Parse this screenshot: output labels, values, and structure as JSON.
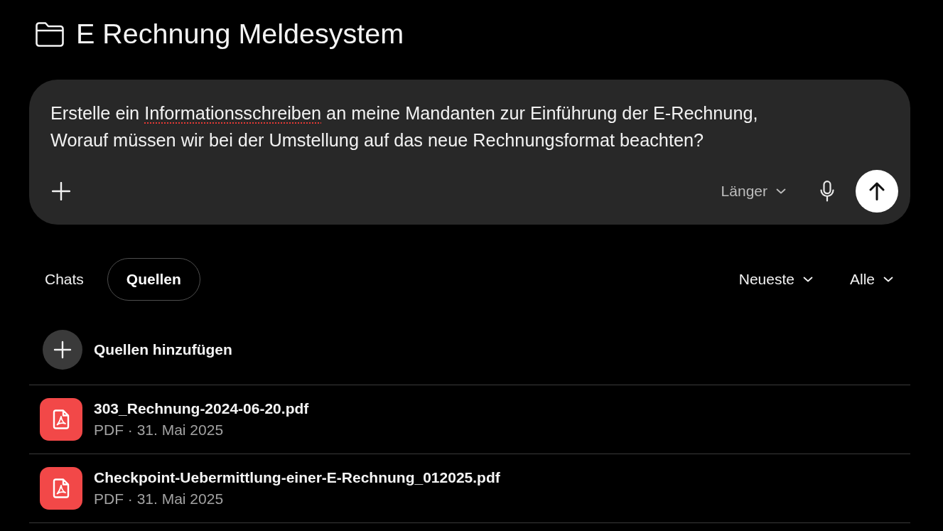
{
  "header": {
    "title": "E Rechnung Meldesystem"
  },
  "composer": {
    "prompt": [
      {
        "text": "Erstelle ein ",
        "misspelled": false
      },
      {
        "text": "Informationsschreiben",
        "misspelled": true
      },
      {
        "text": " an meine Mandanten zur Einführung der E-Rechnung,\nWorauf müssen wir bei der Umstellung auf das neue Rechnungsformat beachten?",
        "misspelled": false
      }
    ],
    "length_option": {
      "label": "Länger"
    }
  },
  "tabs": [
    {
      "label": "Chats",
      "selected": false
    },
    {
      "label": "Quellen",
      "selected": true
    }
  ],
  "filters": [
    {
      "label": "Neueste"
    },
    {
      "label": "Alle"
    }
  ],
  "add_source": {
    "label": "Quellen hinzufügen"
  },
  "sources": [
    {
      "name": "303_Rechnung-2024-06-20.pdf",
      "meta": "PDF · 31. Mai 2025"
    },
    {
      "name": "Checkpoint-Uebermittlung-einer-E-Rechnung_012025.pdf",
      "meta": "PDF · 31. Mai 2025"
    }
  ]
}
